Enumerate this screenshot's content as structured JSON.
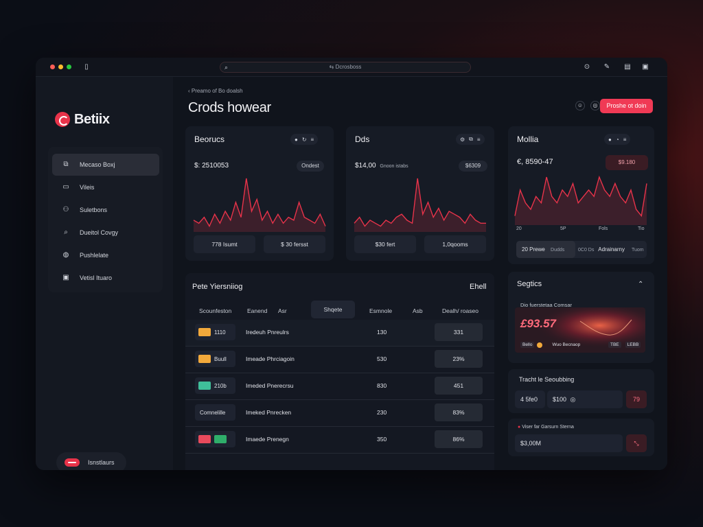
{
  "window": {
    "url": "⇆ Dcrosboss"
  },
  "brand": {
    "name": "Betiix"
  },
  "sidebar": {
    "items": [
      {
        "label": "Mecaso Boxj",
        "icon": "layers-icon"
      },
      {
        "label": "Vileis",
        "icon": "file-icon"
      },
      {
        "label": "Suletbons",
        "icon": "users-icon"
      },
      {
        "label": "Dueitol Covgy",
        "icon": "search-icon"
      },
      {
        "label": "Pushlelate",
        "icon": "shield-icon"
      },
      {
        "label": "Vetisl Ituaro",
        "icon": "wallet-icon"
      }
    ],
    "footer_label": "Isnstlaurs"
  },
  "header": {
    "breadcrumb": "Preamo of Bo doalsh",
    "title": "Crods howear",
    "primary_button": "Proshe ot doin"
  },
  "cards": [
    {
      "title": "Beorucs",
      "amount": "$: 2510053",
      "pill": "Ondest",
      "stat_left": "778 Isumt",
      "stat_right": "$ 30 fersst",
      "series": [
        6,
        5,
        7,
        4,
        8,
        5,
        9,
        6,
        12,
        7,
        20,
        9,
        13,
        6,
        9,
        5,
        8,
        5,
        7,
        6,
        12,
        7,
        6,
        5,
        8,
        4
      ]
    },
    {
      "title": "Dds",
      "amount": "$14,00",
      "sub": "Gnoon istabs",
      "pill": "$6309",
      "stat_left": "$30 fert",
      "stat_right": "1,0qooms",
      "series": [
        5,
        7,
        4,
        6,
        5,
        4,
        6,
        5,
        7,
        8,
        6,
        5,
        20,
        8,
        12,
        7,
        10,
        6,
        9,
        8,
        7,
        5,
        8,
        6,
        5,
        5
      ]
    },
    {
      "title": "Mollia",
      "amount": "€, 8590-47",
      "pill": "$9.180",
      "series": [
        10,
        14,
        12,
        11,
        13,
        12,
        16,
        13,
        12,
        14,
        13,
        15,
        12,
        13,
        14,
        13,
        16,
        14,
        13,
        15,
        13,
        12,
        14,
        11,
        10,
        15
      ],
      "axis": [
        "20",
        "5P",
        "Fols",
        "Tio"
      ],
      "tab_left": "20 Prewe",
      "tab_left_sub": "Dudds",
      "tab_right": "0C0 Ds",
      "tab_right_sub": "Adrainarny",
      "tab_right_extra": "Tuom"
    }
  ],
  "table": {
    "title": "Pete Yiersniiog",
    "right_label": "Ehell",
    "columns": [
      "Scounfeston",
      "Eanend",
      "Asr",
      "Shqete",
      "Esmnole",
      "Asb",
      "Dealh/ roaseo"
    ],
    "rows": [
      {
        "tag": "1110",
        "chip": "#f2a93b",
        "name": "Iredeuh Pnreulrs",
        "value": "130",
        "pct": "331"
      },
      {
        "tag": "Buull",
        "chip": "#f2a93b",
        "name": "Imeade Phrciagoin",
        "value": "530",
        "pct": "23%"
      },
      {
        "tag": "210b",
        "chip": "#3fbf9a",
        "name": "Imeded Pnerecrsu",
        "value": "830",
        "pct": "451"
      },
      {
        "tag": "Comnelille",
        "chip": "",
        "name": "Imeked Pnrecken",
        "value": "230",
        "pct": "83%"
      },
      {
        "tag": "",
        "chip": "#e84a5c",
        "name": "Imaede Prenegn",
        "value": "350",
        "pct": "86%"
      }
    ]
  },
  "right_panels": {
    "graphics": {
      "title": "Segtics",
      "sub": "Dio fuerstetaa  Comsar",
      "value": "£93.57",
      "legend_left": "Bello",
      "legend_mid": "Wuo Becnaop",
      "legend_right1": "TBE",
      "legend_right2": "LEBB"
    },
    "tracking": {
      "title": "Tracht le Seoubbing",
      "field_left": "4 5fe0",
      "field_mid": "$100",
      "button": "79"
    },
    "summary": {
      "caption": "Viser far Garsurn Sterna",
      "value": "$3,00M",
      "button": "⤡"
    }
  },
  "colors": {
    "accent": "#f03a55",
    "line": "#e8334a"
  }
}
